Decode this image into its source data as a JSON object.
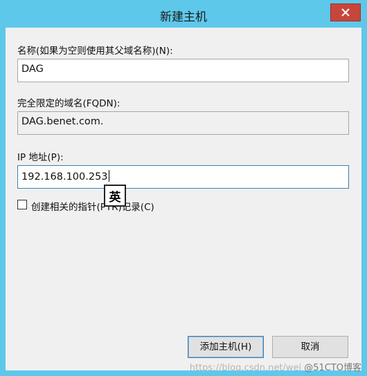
{
  "window": {
    "title": "新建主机"
  },
  "form": {
    "name_label": "名称(如果为空则使用其父域名称)(N):",
    "name_value": "DAG",
    "fqdn_label": "完全限定的域名(FQDN):",
    "fqdn_value": "DAG.benet.com.",
    "ip_label": "IP 地址(P):",
    "ip_value": "192.168.100.253",
    "ptr_checkbox_label": "创建相关的指针(PTR)记录(C)",
    "ptr_checked": false
  },
  "ime": {
    "indicator": "英"
  },
  "buttons": {
    "add_host": "添加主机(H)",
    "cancel": "取消"
  },
  "watermark": {
    "url": "https://blog.csdn.net/wei",
    "brand": "@51CTO博客"
  },
  "colors": {
    "titlebar": "#5ec8ea",
    "close": "#c7463b",
    "client": "#f0f0f0"
  }
}
